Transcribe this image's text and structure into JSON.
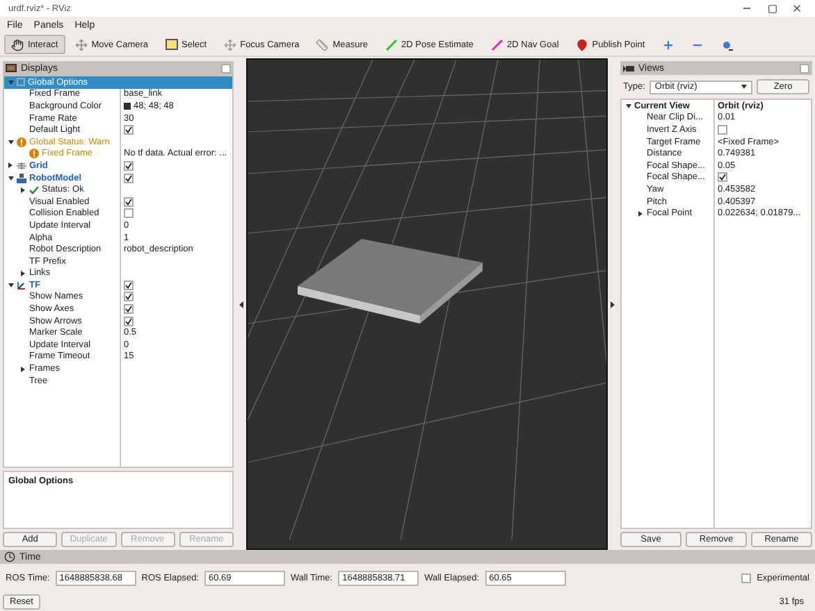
{
  "window": {
    "title": "urdf.rviz* - RViz"
  },
  "menu": [
    "File",
    "Panels",
    "Help"
  ],
  "toolbar": [
    {
      "kind": "interact",
      "label": "Interact",
      "selected": true
    },
    {
      "kind": "move",
      "label": "Move Camera",
      "selected": false
    },
    {
      "kind": "select",
      "label": "Select",
      "selected": false
    },
    {
      "kind": "focus",
      "label": "Focus Camera",
      "selected": false
    },
    {
      "kind": "measure",
      "label": "Measure",
      "selected": false
    },
    {
      "kind": "pose",
      "label": "2D Pose Estimate",
      "selected": false
    },
    {
      "kind": "goal",
      "label": "2D Nav Goal",
      "selected": false
    },
    {
      "kind": "point",
      "label": "Publish Point",
      "selected": false
    },
    {
      "kind": "add",
      "selected": false
    },
    {
      "kind": "remove",
      "selected": false
    },
    {
      "kind": "props",
      "selected": false
    }
  ],
  "displays": {
    "title": "Displays",
    "items": [
      {
        "kind": "options",
        "label": "Global Options",
        "selected": true,
        "expanded": true,
        "children": [
          {
            "kind": "property",
            "label": "Fixed Frame",
            "value": "base_link",
            "selected": false
          },
          {
            "kind": "property",
            "label": "Background Color",
            "value": "48; 48; 48",
            "color": "#303030",
            "selected": false
          },
          {
            "kind": "property",
            "label": "Frame Rate",
            "value": "30",
            "selected": false
          },
          {
            "kind": "property",
            "label": "Default Light",
            "checked": true,
            "selected": false
          }
        ]
      },
      {
        "kind": "warning",
        "label": "Global Status: Warn",
        "selected": false,
        "expanded": true,
        "children": [
          {
            "kind": "warning",
            "label": "Fixed Frame",
            "value": "No tf data.  Actual error: ...",
            "selected": false
          }
        ]
      },
      {
        "kind": "grid",
        "label": "Grid",
        "checked": true,
        "selected": false,
        "expanded": false
      },
      {
        "kind": "robot",
        "label": "RobotModel",
        "checked": true,
        "selected": false,
        "expanded": true,
        "children": [
          {
            "kind": "ok",
            "label": "Status: Ok",
            "selected": false,
            "expanded": false
          },
          {
            "kind": "property",
            "label": "Visual Enabled",
            "checked": true,
            "selected": false
          },
          {
            "kind": "property",
            "label": "Collision Enabled",
            "checked": false,
            "selected": false
          },
          {
            "kind": "property",
            "label": "Update Interval",
            "value": "0",
            "selected": false
          },
          {
            "kind": "property",
            "label": "Alpha",
            "value": "1",
            "selected": false
          },
          {
            "kind": "property",
            "label": "Robot Description",
            "value": "robot_description",
            "selected": false
          },
          {
            "kind": "property",
            "label": "TF Prefix",
            "selected": false
          },
          {
            "kind": "property",
            "label": "Links",
            "selected": false,
            "expanded": false
          }
        ]
      },
      {
        "kind": "tf",
        "label": "TF",
        "checked": true,
        "selected": false,
        "expanded": true,
        "children": [
          {
            "kind": "property",
            "label": "Show Names",
            "checked": true,
            "selected": false
          },
          {
            "kind": "property",
            "label": "Show Axes",
            "checked": true,
            "selected": false
          },
          {
            "kind": "property",
            "label": "Show Arrows",
            "checked": true,
            "selected": false
          },
          {
            "kind": "property",
            "label": "Marker Scale",
            "value": "0.5",
            "selected": false
          },
          {
            "kind": "property",
            "label": "Update Interval",
            "value": "0",
            "selected": false
          },
          {
            "kind": "property",
            "label": "Frame Timeout",
            "value": "15",
            "selected": false
          },
          {
            "kind": "property",
            "label": "Frames",
            "selected": false,
            "expanded": false
          },
          {
            "kind": "property",
            "label": "Tree",
            "selected": false
          }
        ]
      }
    ],
    "description": "Global Options",
    "buttons": [
      {
        "label": "Add",
        "disabled": false
      },
      {
        "label": "Duplicate",
        "disabled": true
      },
      {
        "label": "Remove",
        "disabled": true
      },
      {
        "label": "Rename",
        "disabled": true
      }
    ]
  },
  "views": {
    "title": "Views",
    "type_label": "Type:",
    "type_value": "Orbit (rviz)",
    "zero_button": "Zero",
    "items": [
      {
        "kind": "current",
        "label": "Current View",
        "value": "Orbit (rviz)",
        "expanded": true,
        "children": [
          {
            "label": "Near Clip Di...",
            "value": "0.01"
          },
          {
            "label": "Invert Z Axis",
            "checked": false
          },
          {
            "label": "Target Frame",
            "value": "<Fixed Frame>"
          },
          {
            "label": "Distance",
            "value": "0.749381"
          },
          {
            "label": "Focal Shape...",
            "value": "0.05"
          },
          {
            "label": "Focal Shape...",
            "checked": true
          },
          {
            "label": "Yaw",
            "value": "0.453582"
          },
          {
            "label": "Pitch",
            "value": "0.405397"
          },
          {
            "label": "Focal Point",
            "value": "0.022634; 0.01879...",
            "expanded": false
          }
        ]
      }
    ],
    "buttons": [
      "Save",
      "Remove",
      "Rename"
    ]
  },
  "time": {
    "title": "Time",
    "fields": [
      {
        "label": "ROS Time:",
        "value": "1648885838.68"
      },
      {
        "label": "ROS Elapsed:",
        "value": "60.69"
      },
      {
        "label": "Wall Time:",
        "value": "1648885838.71"
      },
      {
        "label": "Wall Elapsed:",
        "value": "60.65"
      }
    ],
    "experimental": {
      "label": "Experimental",
      "checked": false
    },
    "reset_button": "Reset",
    "fps": "31 fps"
  }
}
